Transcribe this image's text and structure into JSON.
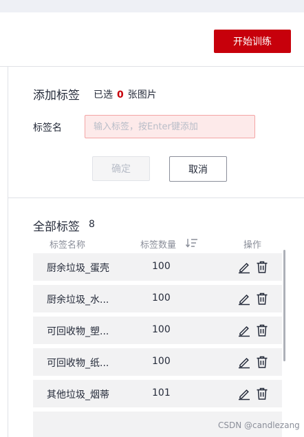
{
  "header": {
    "train_button": "开始训练"
  },
  "add_tag": {
    "title": "添加标签",
    "selected_prefix": "已选",
    "selected_count": "0",
    "selected_suffix": "张图片",
    "field_label": "标签名",
    "input_placeholder": "输入标签，按Enter键添加",
    "input_value": "",
    "confirm_label": "确定",
    "cancel_label": "取消"
  },
  "all_tags": {
    "title": "全部标签",
    "count": "8",
    "columns": {
      "name": "标签名称",
      "quantity": "标签数量",
      "action": "操作"
    },
    "rows": [
      {
        "name": "厨余垃圾_蛋壳",
        "quantity": "100"
      },
      {
        "name": "厨余垃圾_水...",
        "quantity": "100"
      },
      {
        "name": "可回收物_塑...",
        "quantity": "100"
      },
      {
        "name": "可回收物_纸...",
        "quantity": "100"
      },
      {
        "name": "其他垃圾_烟蒂",
        "quantity": "101"
      },
      {
        "name": "",
        "quantity": ""
      }
    ]
  },
  "watermark": "CSDN @candlezang",
  "colors": {
    "accent": "#c7000b",
    "input_error_bg": "#fdeaea",
    "row_bg": "#f2f2f3"
  },
  "icons": [
    "sort-icon",
    "edit-icon",
    "trash-icon"
  ]
}
